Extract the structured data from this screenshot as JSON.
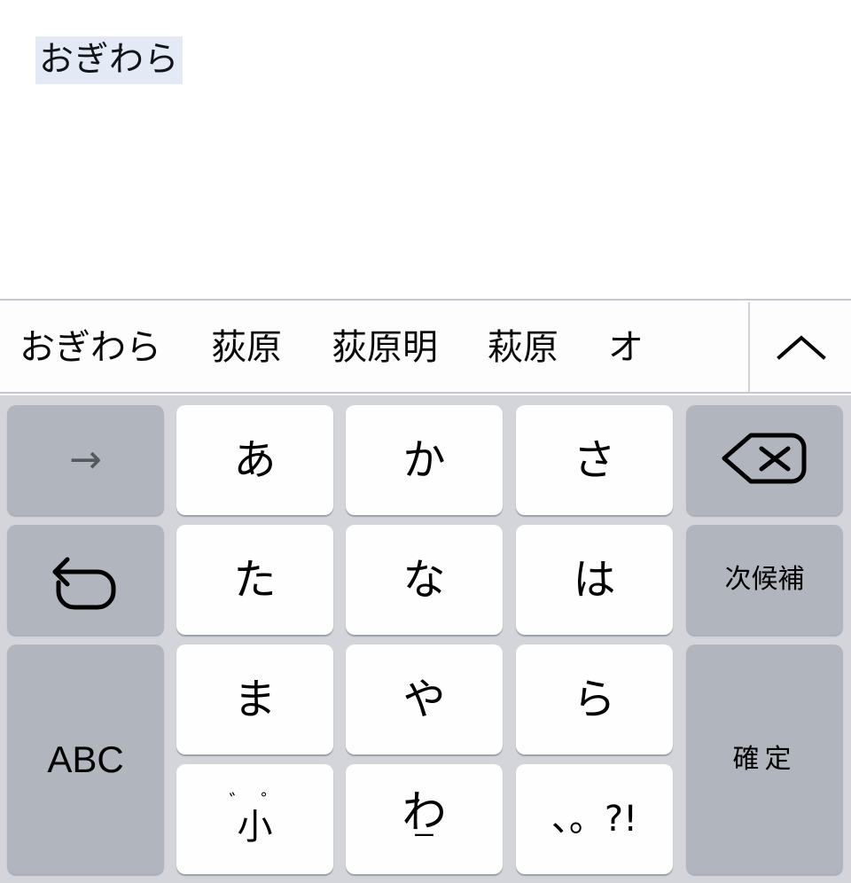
{
  "document": {
    "composing_text": "おぎわら",
    "highlight_color": "#e4e9f6",
    "background_color": "#ffffff"
  },
  "candidate_bar": {
    "candidates": [
      {
        "label": "おぎわら",
        "selected": true
      },
      {
        "label": "荻原",
        "selected": false
      },
      {
        "label": "荻原明",
        "selected": false
      },
      {
        "label": "萩原",
        "selected": false
      },
      {
        "label": "オ",
        "selected": false,
        "clipped": true
      }
    ],
    "expand_icon": "chevron-up-icon",
    "background_color": "#fdfdfd"
  },
  "keyboard": {
    "type": "japanese-kana-10-key",
    "background_color": "#d3d5db",
    "key_white_color": "#fefeff",
    "key_gray_color": "#b0b5be",
    "keys": {
      "cursor_right": {
        "icon": "arrow-right-icon",
        "glyph": "→"
      },
      "a": "あ",
      "ka": "か",
      "sa": "さ",
      "delete": {
        "icon": "backspace-icon"
      },
      "undo": {
        "icon": "undo-icon"
      },
      "ta": "た",
      "na": "な",
      "ha": "は",
      "next_candidate": "次候補",
      "abc": "ABC",
      "ma": "ま",
      "ya": "や",
      "ra": "ら",
      "confirm": "確定",
      "dakuten_top": "゛゜",
      "dakuten_main": "小",
      "wa_main": "わ",
      "wa_bottom": "ー",
      "punctuation": "、。?!"
    }
  }
}
